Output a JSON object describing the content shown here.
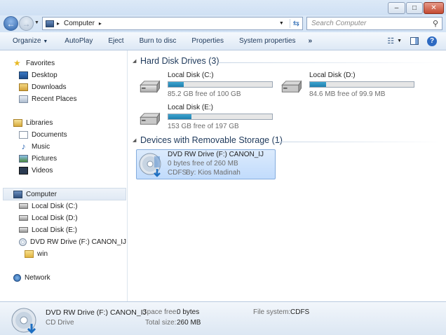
{
  "window": {
    "minimize_glyph": "–",
    "maximize_glyph": "□",
    "close_glyph": "✕"
  },
  "address": {
    "path": "Computer",
    "search_placeholder": "Search Computer"
  },
  "toolbar": {
    "organize": "Organize",
    "autoplay": "AutoPlay",
    "eject": "Eject",
    "burn": "Burn to disc",
    "properties": "Properties",
    "system_properties": "System properties",
    "more": "»"
  },
  "nav": {
    "favorites": "Favorites",
    "desktop": "Desktop",
    "downloads": "Downloads",
    "recent": "Recent Places",
    "libraries": "Libraries",
    "documents": "Documents",
    "music": "Music",
    "pictures": "Pictures",
    "videos": "Videos",
    "computer": "Computer",
    "disk_c": "Local Disk (C:)",
    "disk_d": "Local Disk (D:)",
    "disk_e": "Local Disk (E:)",
    "dvd": "DVD RW Drive (F:) CANON_IJ",
    "win": "win",
    "network": "Network"
  },
  "groups": {
    "hdd": "Hard Disk Drives (3)",
    "removable": "Devices with Removable Storage (1)"
  },
  "drives": [
    {
      "name": "Local Disk (C:)",
      "free": "85.2 GB free of 100 GB",
      "used_fraction": 0.148
    },
    {
      "name": "Local Disk (D:)",
      "free": "84.6 MB free of 99.9 MB",
      "used_fraction": 0.153
    },
    {
      "name": "Local Disk (E:)",
      "free": "153 GB free of 197 GB",
      "used_fraction": 0.223
    }
  ],
  "dvd": {
    "name": "DVD RW Drive (F:) CANON_IJ",
    "free": "0 bytes free of 260 MB",
    "fs": "CDFS",
    "by": "By: Kios Madinah"
  },
  "details": {
    "name": "DVD RW Drive (F:) CANON_IJ",
    "type": "CD Drive",
    "space_free_label": "Space free:",
    "space_free": "0 bytes",
    "total_size_label": "Total size:",
    "total_size": "260 MB",
    "fs_label": "File system:",
    "fs": "CDFS"
  },
  "colors": {
    "accent": "#1e395b",
    "bar_fill": "#2a8fbe",
    "selection": "#cde5f7"
  }
}
